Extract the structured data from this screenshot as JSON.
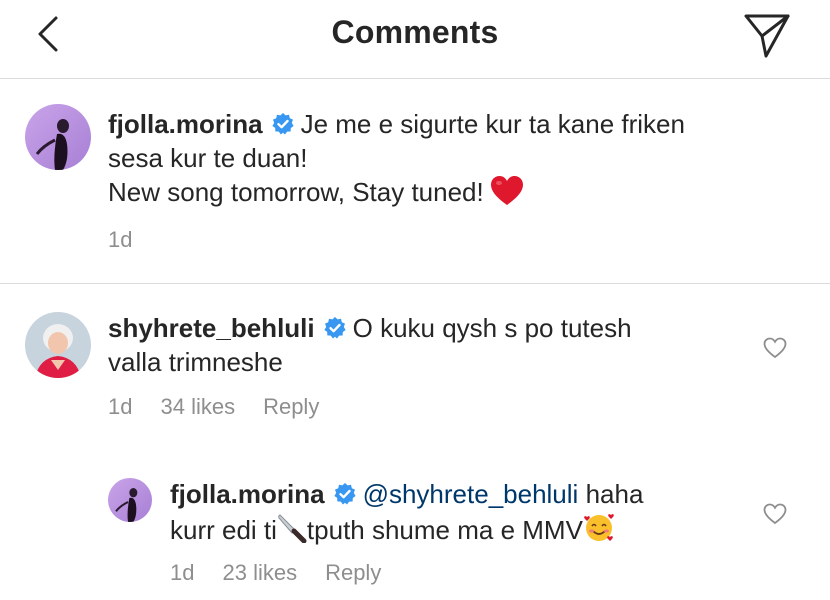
{
  "header": {
    "title": "Comments"
  },
  "caption": {
    "username": "fjolla.morina",
    "line1": "Je me e sigurte kur ta kane friken",
    "line2": "sesa kur te duan!",
    "line3": "New song tomorrow, Stay tuned!",
    "time": "1d"
  },
  "comments": [
    {
      "username": "shyhrete_behluli",
      "line1": "O kuku qysh s po tutesh",
      "line2": "valla trimneshe",
      "time": "1d",
      "likes": "34 likes",
      "reply": "Reply"
    },
    {
      "username": "fjolla.morina",
      "mention": "@shyhrete_behluli",
      "line1_rest": "haha",
      "line2_a": "kurr edi ti",
      "line2_b": "tputh shume ma e MMV",
      "time": "1d",
      "likes": "23 likes",
      "reply": "Reply"
    }
  ],
  "icons": {
    "back": "chevron-left-icon",
    "share": "paper-plane-icon",
    "verified": "verified-badge-icon",
    "heart": "heart-outline-icon",
    "red_heart_emoji": "red-heart-emoji",
    "knife_emoji": "knife-emoji",
    "smiling_hearts_emoji": "smiling-face-with-hearts-emoji"
  },
  "colors": {
    "text": "#262626",
    "meta": "#8e8e8e",
    "divider": "#dbdbdb",
    "verified": "#3897f0",
    "heart": "#e0182d"
  }
}
